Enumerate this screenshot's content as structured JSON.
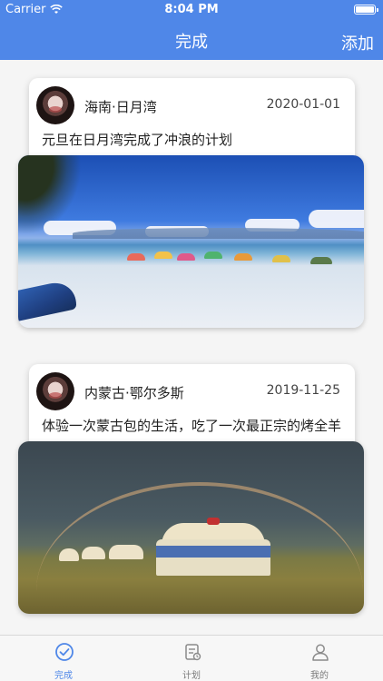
{
  "status_bar": {
    "carrier": "Carrier",
    "time": "8:04 PM"
  },
  "nav": {
    "title": "完成",
    "add_label": "添加"
  },
  "posts": [
    {
      "place": "海南·日月湾",
      "date": "2020-01-01",
      "caption": "元旦在日月湾完成了冲浪的计划",
      "photo": "beach-photo"
    },
    {
      "place": "内蒙古·鄂尔多斯",
      "date": "2019-11-25",
      "caption": "体验一次蒙古包的生活，吃了一次最正宗的烤全羊",
      "photo": "yurt-photo"
    }
  ],
  "tabs": [
    {
      "label": "完成",
      "icon": "check-circle-icon",
      "active": true
    },
    {
      "label": "计划",
      "icon": "plan-list-icon",
      "active": false
    },
    {
      "label": "我的",
      "icon": "person-icon",
      "active": false
    }
  ],
  "colors": {
    "brand": "#4f87e8",
    "tab_inactive": "#7a7a7a"
  }
}
